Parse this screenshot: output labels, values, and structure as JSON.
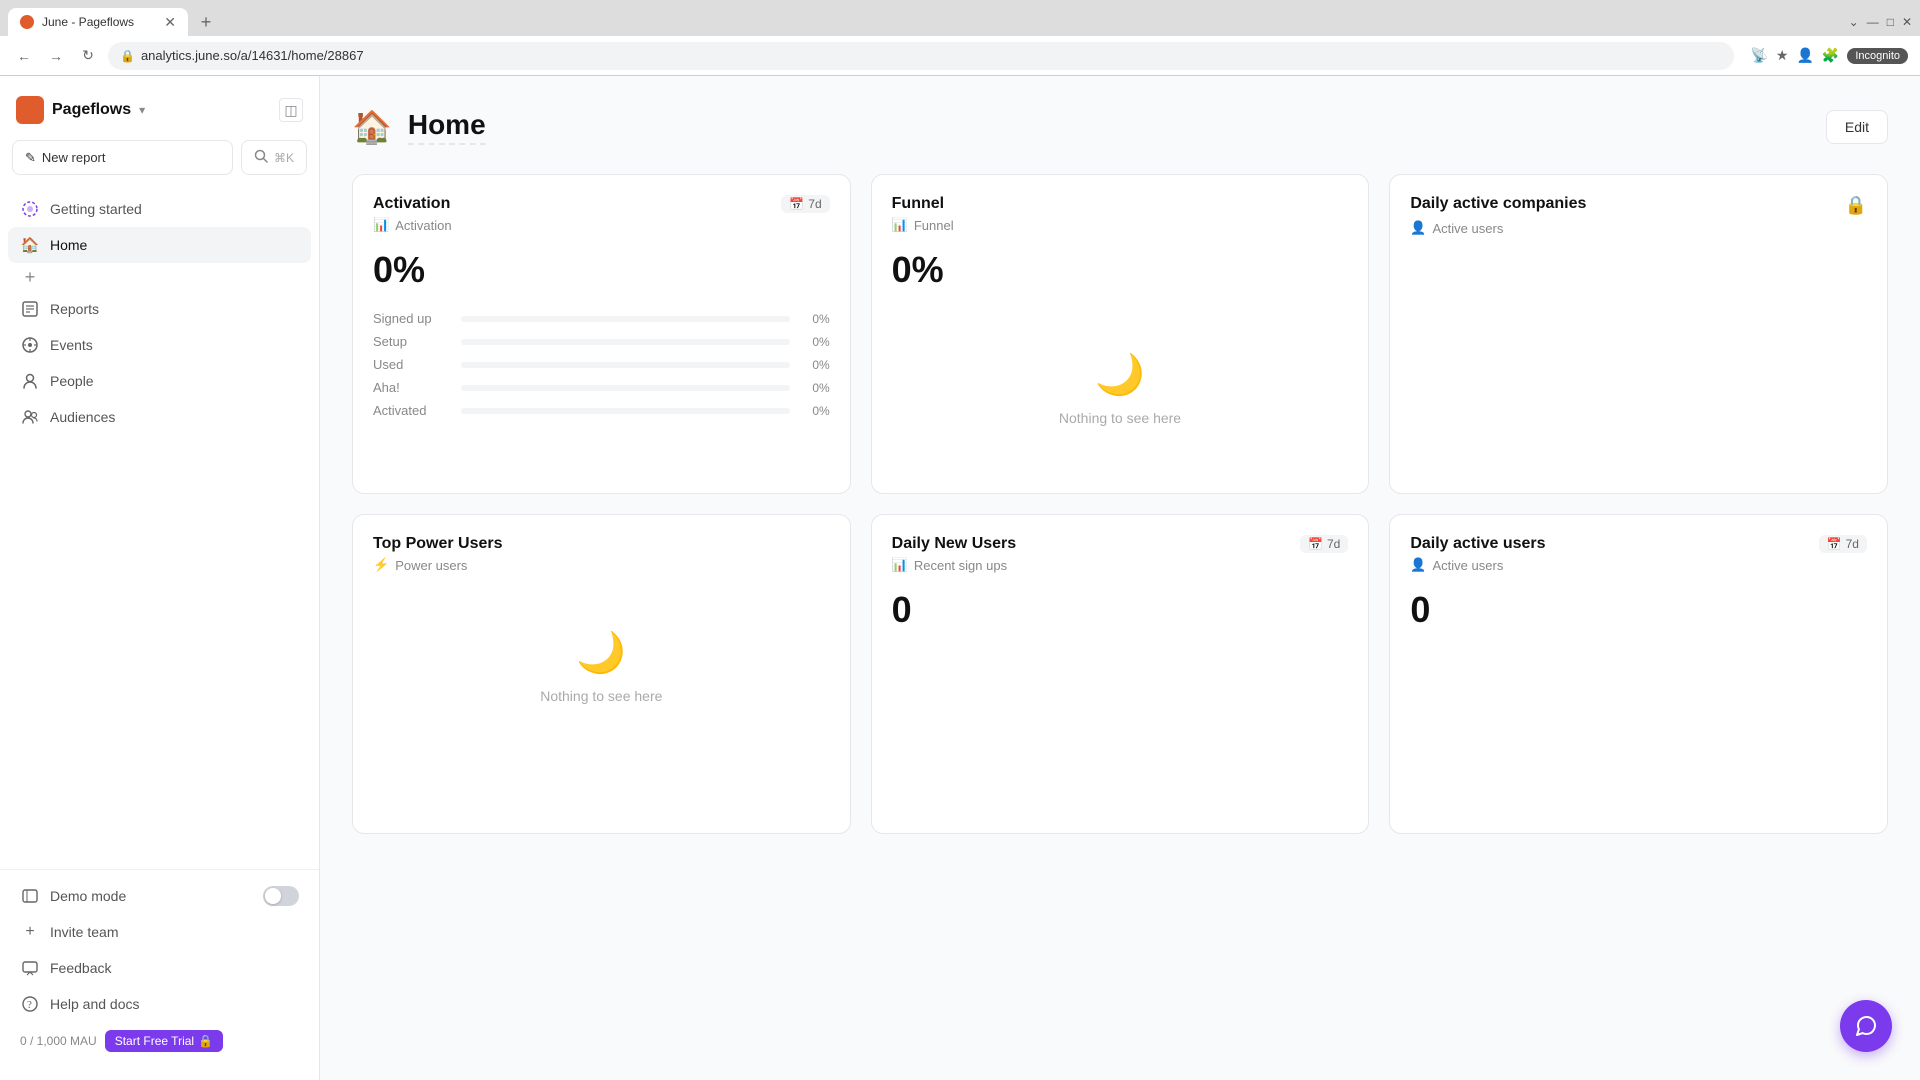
{
  "browser": {
    "tab_title": "June - Pageflows",
    "url": "analytics.june.so/a/14631/home/28867",
    "incognito_label": "Incognito"
  },
  "sidebar": {
    "brand": "Pageflows",
    "new_report_label": "New report",
    "search_label": "⌘K",
    "nav_items": [
      {
        "id": "getting-started",
        "label": "Getting started",
        "icon": "⟳"
      },
      {
        "id": "home",
        "label": "Home",
        "icon": "🏠",
        "active": true
      },
      {
        "id": "reports",
        "label": "Reports",
        "icon": "▤"
      },
      {
        "id": "events",
        "label": "Events",
        "icon": "✦"
      },
      {
        "id": "people",
        "label": "People",
        "icon": "👤"
      },
      {
        "id": "audiences",
        "label": "Audiences",
        "icon": "👥"
      }
    ],
    "bottom_items": [
      {
        "id": "demo-mode",
        "label": "Demo mode"
      },
      {
        "id": "invite-team",
        "label": "Invite team",
        "icon": "+"
      },
      {
        "id": "feedback",
        "label": "Feedback",
        "icon": "💬"
      },
      {
        "id": "help",
        "label": "Help and docs",
        "icon": "?"
      }
    ],
    "mau_label": "0 / 1,000 MAU",
    "free_trial_label": "Start Free Trial"
  },
  "page": {
    "title": "Home",
    "icon": "🏠",
    "edit_label": "Edit"
  },
  "cards": [
    {
      "id": "activation",
      "title": "Activation",
      "subtitle": "Activation",
      "subtitle_icon": "📊",
      "badge": "7d",
      "badge_icon": "📅",
      "value": "0%",
      "rows": [
        {
          "label": "Signed up",
          "pct": "0%"
        },
        {
          "label": "Setup",
          "pct": "0%"
        },
        {
          "label": "Used",
          "pct": "0%"
        },
        {
          "label": "Aha!",
          "pct": "0%"
        },
        {
          "label": "Activated",
          "pct": "0%"
        }
      ]
    },
    {
      "id": "funnel",
      "title": "Funnel",
      "subtitle": "Funnel",
      "subtitle_icon": "📊",
      "value": "0%",
      "empty": true,
      "empty_text": "Nothing to see here"
    },
    {
      "id": "daily-active-companies",
      "title": "Daily active companies",
      "subtitle": "Active users",
      "subtitle_icon": "👤",
      "locked": true,
      "empty": false
    }
  ],
  "cards2": [
    {
      "id": "top-power-users",
      "title": "Top Power Users",
      "subtitle": "Power users",
      "subtitle_icon": "⚡",
      "empty": true,
      "empty_text": "Nothing to see here"
    },
    {
      "id": "daily-new-users",
      "title": "Daily New Users",
      "subtitle": "Recent sign ups",
      "subtitle_icon": "📊",
      "badge": "7d",
      "badge_icon": "📅",
      "value": "0"
    },
    {
      "id": "daily-active-users",
      "title": "Daily active users",
      "subtitle": "Active users",
      "subtitle_icon": "👤",
      "badge": "7d",
      "badge_icon": "📅",
      "value": "0"
    }
  ]
}
